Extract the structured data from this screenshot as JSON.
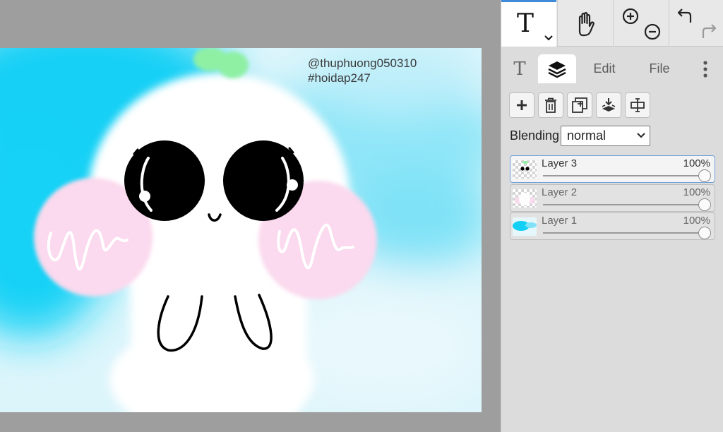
{
  "canvas": {
    "watermark_line1": "@thuphuong050310",
    "watermark_line2": "#hoidap247"
  },
  "toolbar": {
    "tools": [
      {
        "id": "text",
        "icon": "text-tool-icon",
        "glyph": "T",
        "active": true
      },
      {
        "id": "hand",
        "icon": "hand-icon"
      },
      {
        "id": "zoom",
        "icons": [
          "zoom-in-icon",
          "zoom-out-icon"
        ]
      },
      {
        "id": "history",
        "icons": [
          "undo-icon",
          "redo-icon"
        ]
      }
    ]
  },
  "tabs": {
    "text_glyph": "T",
    "layers_icon": "layers-icon",
    "edit_label": "Edit",
    "file_label": "File",
    "more_icon": "more-vertical-icon",
    "active": "layers"
  },
  "layer_actions": [
    "add-layer-icon",
    "delete-layer-icon",
    "duplicate-layer-icon",
    "merge-down-icon",
    "layer-properties-icon"
  ],
  "blending": {
    "label": "Blending",
    "value": "normal"
  },
  "layers": [
    {
      "name": "Layer 3",
      "opacity": "100%",
      "opacity_value": 100,
      "selected": true
    },
    {
      "name": "Layer 2",
      "opacity": "100%",
      "opacity_value": 100,
      "selected": false
    },
    {
      "name": "Layer 1",
      "opacity": "100%",
      "opacity_value": 100,
      "selected": false
    }
  ],
  "colors": {
    "accent": "#3d8bd9",
    "cyan": "#12d0f5",
    "cheek_pink": "#fbd9ee",
    "sprout_green": "#8ff0a4"
  }
}
